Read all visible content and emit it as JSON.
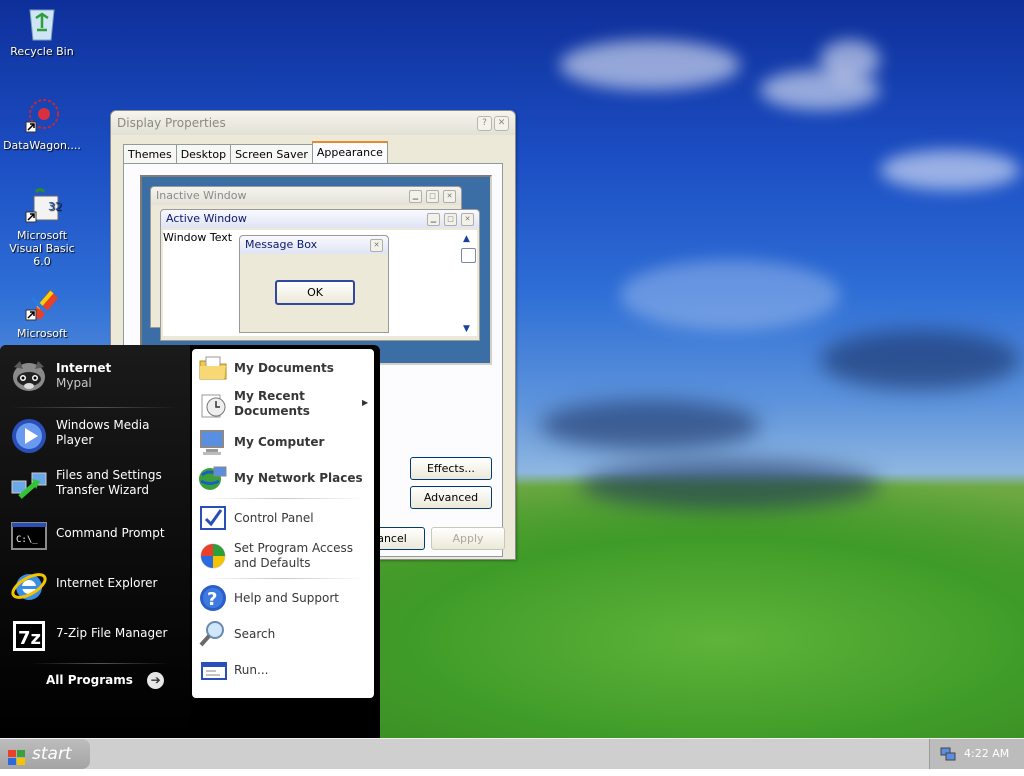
{
  "desktop": {
    "icons": [
      {
        "label": "Recycle Bin",
        "icon": "recycle-bin-icon"
      },
      {
        "label": "DataWagon....",
        "icon": "datawagon-icon"
      },
      {
        "label": "Microsoft Visual Basic 6.0",
        "icon": "visual-basic-icon"
      },
      {
        "label": "Microsoft",
        "icon": "microsoft-app-icon"
      }
    ]
  },
  "display_properties": {
    "title": "Display Properties",
    "tabs": [
      "Themes",
      "Desktop",
      "Screen Saver",
      "Appearance"
    ],
    "active_tab": "Appearance",
    "preview": {
      "inactive_title": "Inactive Window",
      "active_title": "Active Window",
      "window_text": "Window Text",
      "message_box_title": "Message Box",
      "ok_label": "OK"
    },
    "buttons": {
      "effects": "Effects...",
      "advanced": "Advanced",
      "cancel": "ancel",
      "apply": "Apply"
    }
  },
  "start_menu": {
    "user": {
      "title": "Internet",
      "subtitle": "Mypal"
    },
    "left_items": [
      {
        "label": "Windows Media Player",
        "icon": "media-player-icon"
      },
      {
        "label": "Files and Settings Transfer Wizard",
        "icon": "transfer-wizard-icon"
      },
      {
        "label": "Command Prompt",
        "icon": "command-prompt-icon"
      },
      {
        "label": "Internet Explorer",
        "icon": "internet-explorer-icon"
      },
      {
        "label": "7-Zip File Manager",
        "icon": "7zip-icon"
      }
    ],
    "all_programs": "All Programs",
    "right_items": [
      {
        "label": "My Documents",
        "icon": "my-documents-icon"
      },
      {
        "label": "My Recent Documents",
        "icon": "recent-documents-icon"
      },
      {
        "label": "My Computer",
        "icon": "my-computer-icon"
      },
      {
        "label": "My Network Places",
        "icon": "network-places-icon"
      },
      {
        "label": "Control Panel",
        "icon": "control-panel-icon"
      },
      {
        "label": "Set Program Access and Defaults",
        "icon": "program-access-icon"
      },
      {
        "label": "Help and Support",
        "icon": "help-icon"
      },
      {
        "label": "Search",
        "icon": "search-icon"
      },
      {
        "label": "Run...",
        "icon": "run-icon"
      }
    ]
  },
  "taskbar": {
    "start_label": "start",
    "clock": "4:22 AM"
  }
}
